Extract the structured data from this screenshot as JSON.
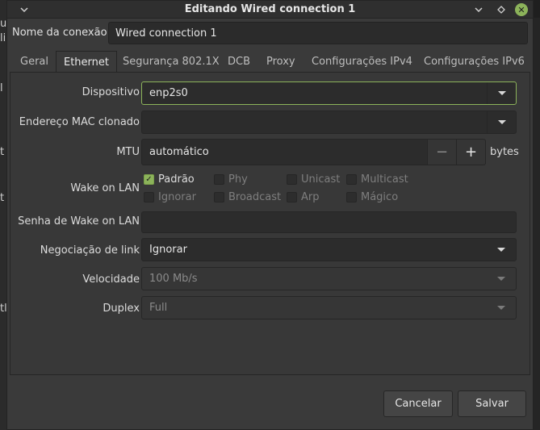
{
  "background": {
    "chars": [
      "u",
      "li",
      "l",
      "t",
      "t",
      "tl"
    ]
  },
  "titlebar": {
    "title": "Editando Wired connection 1",
    "menu_icon": "chevron-down-icon",
    "min_icon": "chevron-down-icon",
    "max_icon": "diamond-icon",
    "close_icon": "close-icon",
    "close_color": "#8cb35a"
  },
  "connection": {
    "label": "Nome da conexão",
    "value": "Wired connection 1"
  },
  "tabs": [
    {
      "label": "Geral",
      "active": false
    },
    {
      "label": "Ethernet",
      "active": true
    },
    {
      "label": "Segurança 802.1X",
      "active": false
    },
    {
      "label": "DCB",
      "active": false
    },
    {
      "label": "Proxy",
      "active": false
    },
    {
      "label": "Configurações IPv4",
      "active": false
    },
    {
      "label": "Configurações IPv6",
      "active": false
    }
  ],
  "ethernet": {
    "device": {
      "label": "Dispositivo",
      "value": "enp2s0"
    },
    "mac": {
      "label": "Endereço MAC clonado",
      "value": ""
    },
    "mtu": {
      "label": "MTU",
      "value": "automático",
      "minus": "−",
      "plus": "+",
      "unit": "bytes"
    },
    "wol": {
      "label": "Wake on LAN",
      "options": [
        {
          "label": "Padrão",
          "checked": true
        },
        {
          "label": "Phy",
          "checked": false
        },
        {
          "label": "Unicast",
          "checked": false
        },
        {
          "label": "Multicast",
          "checked": false
        },
        {
          "label": "Ignorar",
          "checked": false
        },
        {
          "label": "Broadcast",
          "checked": false
        },
        {
          "label": "Arp",
          "checked": false
        },
        {
          "label": "Mágico",
          "checked": false
        }
      ]
    },
    "wol_password": {
      "label": "Senha de Wake on LAN",
      "value": ""
    },
    "link_negotiation": {
      "label": "Negociação de link",
      "value": "Ignorar"
    },
    "speed": {
      "label": "Velocidade",
      "value": "100 Mb/s"
    },
    "duplex": {
      "label": "Duplex",
      "value": "Full"
    }
  },
  "buttons": {
    "cancel": "Cancelar",
    "save": "Salvar"
  },
  "colors": {
    "accent": "#8cb35a",
    "window_bg": "#3a3a3a",
    "field_bg": "#2c2c2c"
  }
}
